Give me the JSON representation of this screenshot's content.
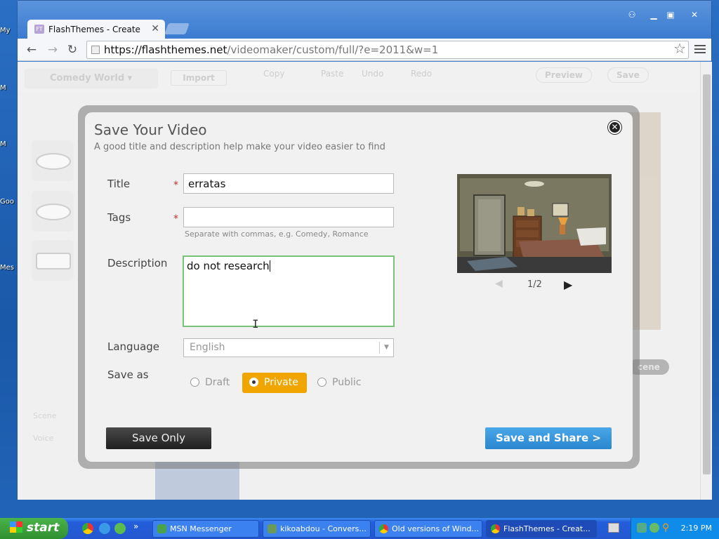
{
  "desktop": {
    "icons": [
      "My",
      "Mes",
      "M",
      "Goo",
      "Mes"
    ]
  },
  "browser": {
    "tab_title": "FlashThemes - Create",
    "tab_favicon": "FT",
    "url_host": "https://flashthemes.net",
    "url_path": "/videomaker/custom/full/?e=2011&w=1",
    "window_buttons": [
      "user-icon",
      "minimize-icon",
      "maximize-icon",
      "close-icon"
    ]
  },
  "app": {
    "theme_dropdown": "Comedy World",
    "import_label": "Import",
    "toolbar": {
      "copy": "Copy",
      "paste": "Paste",
      "undo": "Undo",
      "redo": "Redo",
      "preview": "Preview",
      "save": "Save"
    },
    "side_labels": {
      "scene": "Scene",
      "voice": "Voice"
    },
    "scene_btn": "cene"
  },
  "modal": {
    "title": "Save Your Video",
    "subtitle": "A good title and description help make your video easier to find",
    "title_label": "Title",
    "title_value": "erratas",
    "tags_label": "Tags",
    "tags_value": "",
    "tags_hint": "Separate with commas, e.g. Comedy, Romance",
    "required_mark": "*",
    "description_label": "Description",
    "description_value": "do not research",
    "language_label": "Language",
    "language_value": "English",
    "save_as_label": "Save as",
    "save_options": [
      "Draft",
      "Private",
      "Public"
    ],
    "selected_option": "Private",
    "pager": "1/2",
    "save_only": "Save Only",
    "save_and_share": "Save and Share >"
  },
  "taskbar": {
    "start": "start",
    "tasks": [
      "MSN Messenger",
      "kikoabdou - Convers...",
      "Old versions of Wind...",
      "FlashThemes - Creat..."
    ],
    "active_task": "FlashThemes - Creat...",
    "clock": "2:19 PM"
  },
  "colors": {
    "accent_orange": "#f0a500",
    "accent_blue": "#2a86cf",
    "focus_green": "#7cc37a",
    "required_red": "#c8322e"
  }
}
